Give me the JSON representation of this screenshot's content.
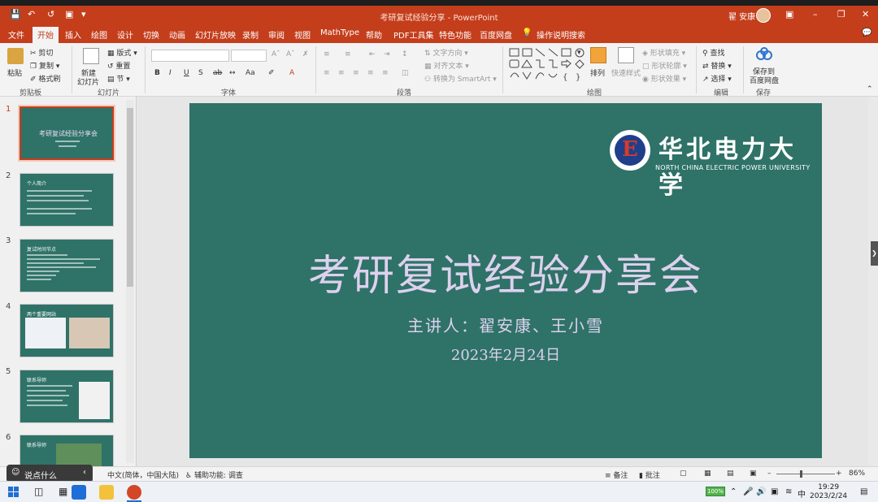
{
  "app": {
    "window_title": "考研复试经验分享 - PowerPoint",
    "user_name": "翟 安康"
  },
  "menu_tabs": [
    "文件",
    "开始",
    "插入",
    "绘图",
    "设计",
    "切换",
    "动画",
    "幻灯片放映",
    "录制",
    "审阅",
    "视图",
    "MathType",
    "帮助",
    "PDF工具集",
    "特色功能",
    "百度网盘",
    "操作说明搜索"
  ],
  "active_tab": "开始",
  "ribbon": {
    "clipboard": {
      "paste": "粘贴",
      "cut": "剪切",
      "copy": "复制",
      "format_painter": "格式刷",
      "group": "剪贴板"
    },
    "slides": {
      "new_slide": "新建",
      "new_slide2": "幻灯片",
      "layout": "版式",
      "reset": "重置",
      "section": "节",
      "group": "幻灯片"
    },
    "font": {
      "group": "字体"
    },
    "paragraph": {
      "text_direction": "文字方向",
      "align_text": "对齐文本",
      "smartart": "转换为 SmartArt",
      "group": "段落"
    },
    "drawing": {
      "arrange": "排列",
      "quick_styles": "快速样式",
      "shape_fill": "形状填充",
      "shape_outline": "形状轮廓",
      "shape_effects": "形状效果",
      "group": "绘图"
    },
    "editing": {
      "find": "查找",
      "replace": "替换",
      "select": "选择",
      "group": "编辑"
    },
    "save": {
      "save_to": "保存到",
      "baidu": "百度网盘",
      "group": "保存"
    }
  },
  "thumbnails": [
    {
      "num": "1",
      "title": "考研复试经验分享会"
    },
    {
      "num": "2",
      "title": "个人简介"
    },
    {
      "num": "3",
      "title": "复试时间节点"
    },
    {
      "num": "4",
      "title": "两个重要网站"
    },
    {
      "num": "5",
      "title": "联系导师"
    },
    {
      "num": "6",
      "title": "联系导师"
    }
  ],
  "slide": {
    "logo_cn": "华北电力大学",
    "logo_en": "NORTH CHINA ELECTRIC POWER UNIVERSITY",
    "title": "考研复试经验分享会",
    "presenters": "主讲人：翟安康、王小雪",
    "date": "2023年2月24日"
  },
  "status": {
    "language": "中文(简体，中国大陆)",
    "accessibility": "辅助功能: 调查",
    "notes": "备注",
    "comments": "批注",
    "zoom": "86%"
  },
  "overlay_hint": "说点什么",
  "taskbar": {
    "battery": "100%",
    "ime": "中",
    "time": "19:29",
    "date": "2023/2/24"
  },
  "colors": {
    "accent": "#c43e1c",
    "slide_bg": "#2f7268",
    "slide_text": "#ddd1ee"
  }
}
